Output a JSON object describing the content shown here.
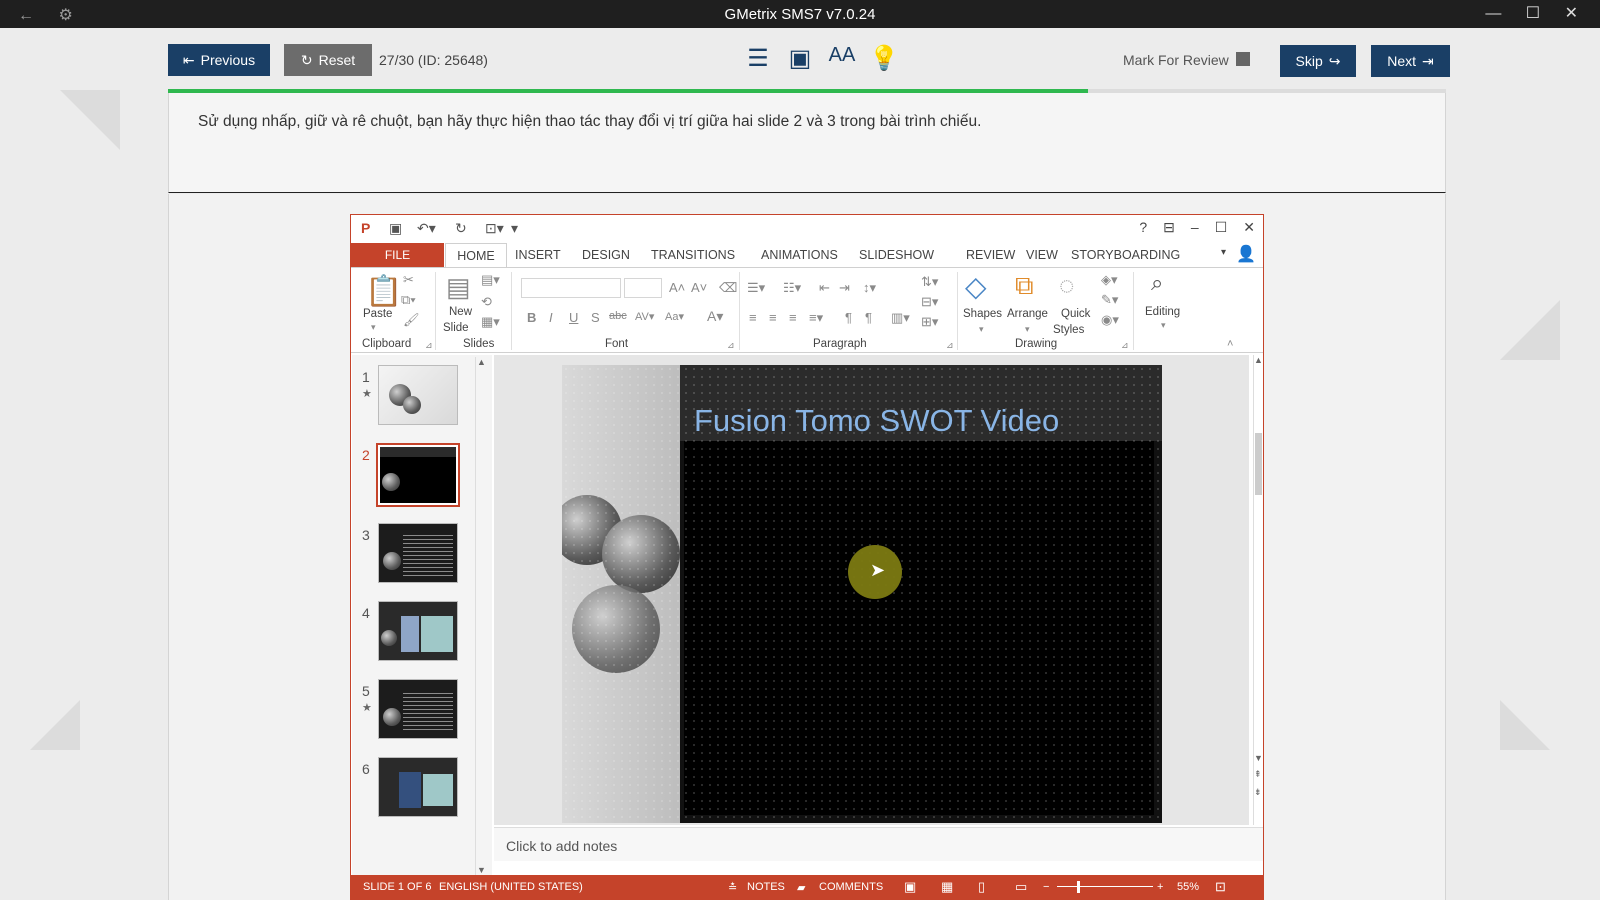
{
  "window": {
    "title": "GMetrix SMS7 v7.0.24"
  },
  "nav": {
    "previous_label": "Previous",
    "reset_label": "Reset",
    "question_counter": "27/30 (ID: 25648)",
    "mark_label": "Mark For Review",
    "skip_label": "Skip",
    "next_label": "Next",
    "progress_percent": 72
  },
  "question": {
    "text": "Sử dụng nhấp, giữ và rê chuột, bạn hãy thực hiện thao tác thay đổi vị trí giữa hai slide 2 và 3 trong bài trình chiếu."
  },
  "ppt": {
    "tabs": [
      "FILE",
      "HOME",
      "INSERT",
      "DESIGN",
      "TRANSITIONS",
      "ANIMATIONS",
      "SLIDESHOW",
      "REVIEW",
      "VIEW",
      "STORYBOARDING"
    ],
    "ribbon": {
      "paste": "Paste",
      "new_slide_1": "New",
      "new_slide_2": "Slide",
      "shapes": "Shapes",
      "arrange": "Arrange",
      "quick": "Quick",
      "styles": "Styles",
      "editing": "Editing",
      "groups": {
        "clipboard": "Clipboard",
        "slides": "Slides",
        "font": "Font",
        "paragraph": "Paragraph",
        "drawing": "Drawing"
      }
    },
    "slide_numbers": [
      "1",
      "2",
      "3",
      "4",
      "5",
      "6"
    ],
    "selected_slide": 2,
    "slide_title": "Fusion Tomo SWOT Video",
    "notes_placeholder": "Click to add notes",
    "status": {
      "slide_info": "SLIDE 1 OF 6",
      "language": "ENGLISH (UNITED STATES)",
      "notes": "NOTES",
      "comments": "COMMENTS",
      "zoom": "55%"
    },
    "colors": {
      "accent": "#c5432a",
      "title_color": "#89b5e6"
    }
  }
}
